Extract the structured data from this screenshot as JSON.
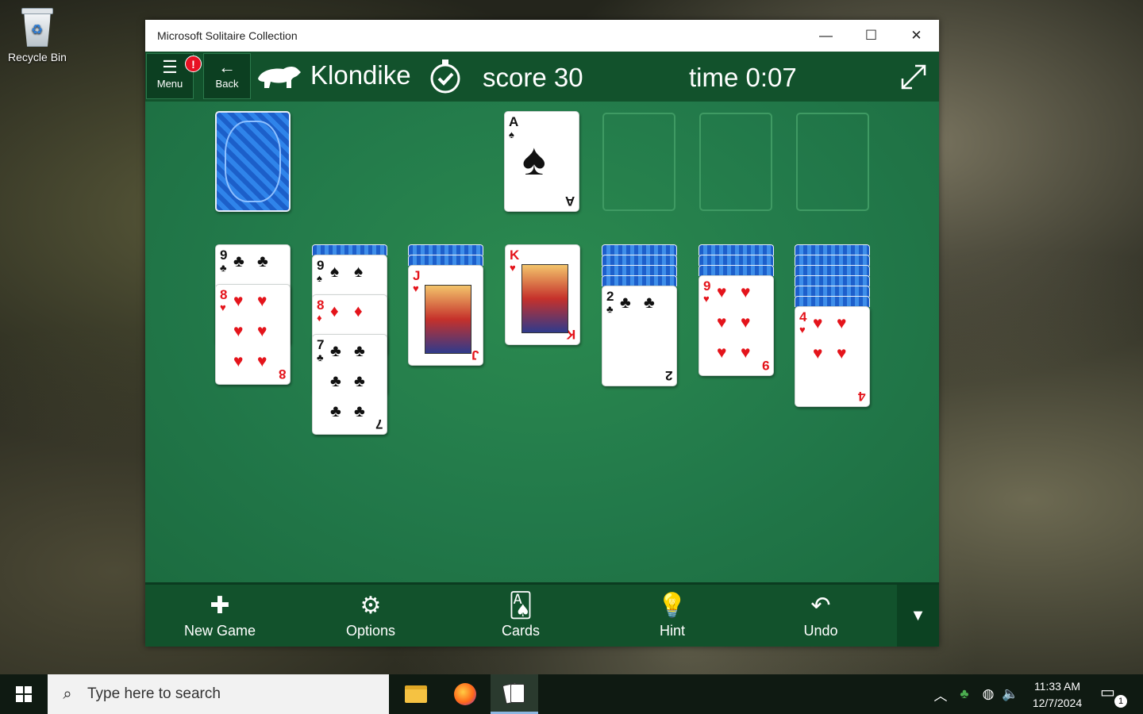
{
  "desktop": {
    "recycle_bin_label": "Recycle Bin"
  },
  "window": {
    "title": "Microsoft Solitaire Collection",
    "minimize": "—",
    "maximize": "☐",
    "close": "✕"
  },
  "topbar": {
    "menu_label": "Menu",
    "menu_badge": "!",
    "back_label": "Back",
    "game_name": "Klondike",
    "score_text": "score  30",
    "time_text": "time  0:07"
  },
  "board": {
    "stock": "face-down",
    "foundations": [
      {
        "rank": "A",
        "suit": "♠",
        "color": "black"
      },
      {
        "rank": "",
        "suit": "",
        "color": ""
      },
      {
        "rank": "",
        "suit": "",
        "color": ""
      },
      {
        "rank": "",
        "suit": "",
        "color": ""
      }
    ],
    "tableau": [
      {
        "facedown": 0,
        "faceup": [
          {
            "rank": "9",
            "suit": "♣",
            "color": "black"
          },
          {
            "rank": "8",
            "suit": "♥",
            "color": "red"
          }
        ]
      },
      {
        "facedown": 1,
        "faceup": [
          {
            "rank": "9",
            "suit": "♠",
            "color": "black"
          },
          {
            "rank": "8",
            "suit": "♦",
            "color": "red"
          },
          {
            "rank": "7",
            "suit": "♣",
            "color": "black"
          }
        ]
      },
      {
        "facedown": 2,
        "faceup": [
          {
            "rank": "J",
            "suit": "♥",
            "color": "red"
          }
        ]
      },
      {
        "facedown": 0,
        "faceup": [
          {
            "rank": "K",
            "suit": "♥",
            "color": "red"
          }
        ]
      },
      {
        "facedown": 4,
        "faceup": [
          {
            "rank": "2",
            "suit": "♣",
            "color": "black"
          }
        ]
      },
      {
        "facedown": 3,
        "faceup": [
          {
            "rank": "9",
            "suit": "♥",
            "color": "red"
          }
        ]
      },
      {
        "facedown": 6,
        "faceup": [
          {
            "rank": "4",
            "suit": "♥",
            "color": "red"
          }
        ]
      }
    ]
  },
  "bottombar": {
    "buttons": [
      {
        "label": "New Game",
        "icon": "plus-icon",
        "glyph": "✚"
      },
      {
        "label": "Options",
        "icon": "gear-icon",
        "glyph": "⚙"
      },
      {
        "label": "Cards",
        "icon": "cards-icon",
        "glyph": "🂡"
      },
      {
        "label": "Hint",
        "icon": "lightbulb-icon",
        "glyph": "💡"
      },
      {
        "label": "Undo",
        "icon": "undo-icon",
        "glyph": "↶"
      }
    ],
    "more_glyph": "▼"
  },
  "taskbar": {
    "search_placeholder": "Type here to search",
    "time": "11:33 AM",
    "date": "12/7/2024",
    "notification_count": "1"
  },
  "colors": {
    "felt": "#22794a",
    "bar": "#12522c",
    "red_suit": "#e4141b"
  }
}
